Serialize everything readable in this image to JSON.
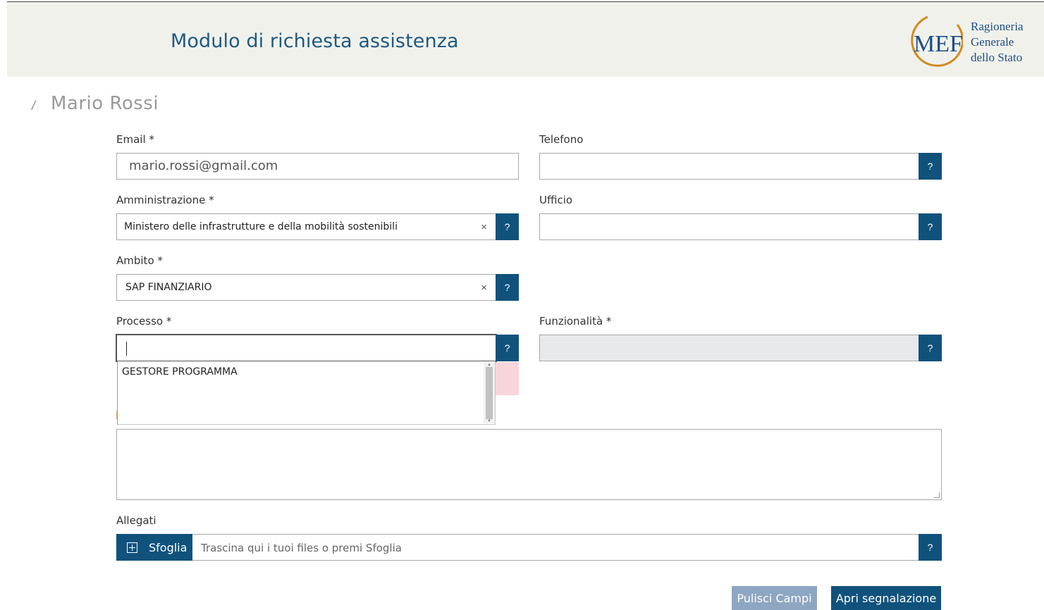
{
  "header": {
    "title": "Modulo di richiesta assistenza",
    "logo_mark": "MEF",
    "logo_lines": [
      "Ragioneria",
      "Generale",
      "dello Stato"
    ]
  },
  "user": {
    "prefix_mark": "/",
    "name": "Mario Rossi"
  },
  "form": {
    "email": {
      "label": "Email *",
      "value": "mario.rossi@gmail.com"
    },
    "telefono": {
      "label": "Telefono",
      "value": ""
    },
    "amministrazione": {
      "label": "Amministrazione *",
      "value": "Ministero delle infrastrutture e della mobilità sostenibili"
    },
    "ufficio": {
      "label": "Ufficio",
      "value": ""
    },
    "ambito": {
      "label": "Ambito *",
      "value": "SAP FINANZIARIO"
    },
    "processo": {
      "label": "Processo *",
      "value": "",
      "options": [
        "GESTORE PROGRAMMA"
      ]
    },
    "funzionalita": {
      "label": "Funzionalità *",
      "value": ""
    },
    "allegati": {
      "label": "Allegati",
      "browse_label": "Sfoglia",
      "drop_hint": "Trascina qui i tuoi files o premi Sfoglia"
    }
  },
  "icons": {
    "help": "?",
    "clear": "×"
  },
  "actions": {
    "clear_label": "Pulisci Campi",
    "submit_label": "Apri segnalazione"
  },
  "colors": {
    "primary": "#10527c",
    "secondary_button": "#8ea6c2",
    "header_bg": "#f1f1ec",
    "title": "#1e5a82"
  }
}
